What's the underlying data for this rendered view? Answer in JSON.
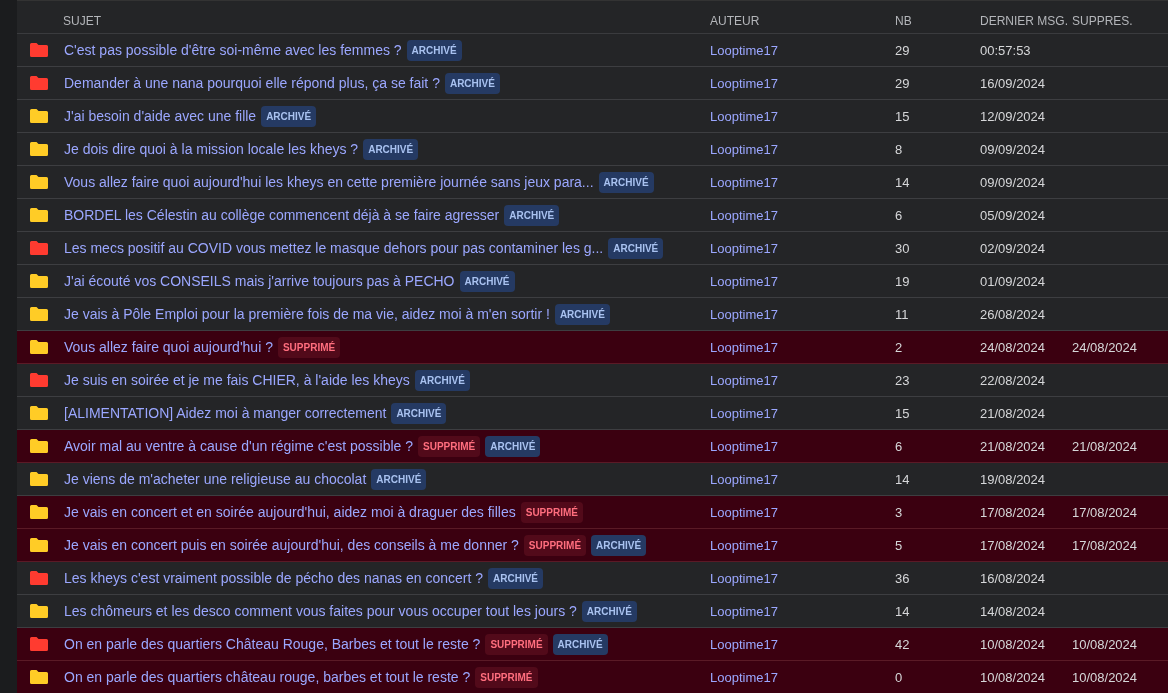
{
  "columns": [
    "SUJET",
    "AUTEUR",
    "NB",
    "DERNIER MSG.",
    "SUPPRES."
  ],
  "rows": [
    {
      "color": "#ff3b30",
      "deleted": false,
      "subject": "C'est pas possible d'être soi-même avec les femmes ?",
      "badges": [
        {
          "kind": "archived",
          "label": "ARCHIVÉ"
        }
      ],
      "author": "Looptime17",
      "count": "29",
      "last": "00:57:53"
    },
    {
      "color": "#ff3b30",
      "deleted": false,
      "subject": "Demander à une nana pourquoi elle répond plus, ça se fait ?",
      "badges": [
        {
          "kind": "archived",
          "label": "ARCHIVÉ"
        }
      ],
      "author": "Looptime17",
      "count": "29",
      "last": "16/09/2024"
    },
    {
      "color": "#ffcc26",
      "deleted": false,
      "subject": "J'ai besoin d'aide avec une fille",
      "badges": [
        {
          "kind": "archived",
          "label": "ARCHIVÉ"
        }
      ],
      "author": "Looptime17",
      "count": "15",
      "last": "12/09/2024"
    },
    {
      "color": "#ffcc26",
      "deleted": false,
      "subject": "Je dois dire quoi à la mission locale les kheys ?",
      "badges": [
        {
          "kind": "archived",
          "label": "ARCHIVÉ"
        }
      ],
      "author": "Looptime17",
      "count": "8",
      "last": "09/09/2024"
    },
    {
      "color": "#ffcc26",
      "deleted": false,
      "subject": "Vous allez faire quoi aujourd'hui les kheys en cette première journée sans jeux para...",
      "badges": [
        {
          "kind": "archived",
          "label": "ARCHIVÉ"
        }
      ],
      "author": "Looptime17",
      "count": "14",
      "last": "09/09/2024"
    },
    {
      "color": "#ffcc26",
      "deleted": false,
      "subject": "BORDEL les Célestin au collège commencent déjà à se faire agresser",
      "badges": [
        {
          "kind": "archived",
          "label": "ARCHIVÉ"
        }
      ],
      "author": "Looptime17",
      "count": "6",
      "last": "05/09/2024"
    },
    {
      "color": "#ff3b30",
      "deleted": false,
      "subject": "Les mecs positif au COVID vous mettez le masque dehors pour pas contaminer les g...",
      "badges": [
        {
          "kind": "archived",
          "label": "ARCHIVÉ"
        }
      ],
      "author": "Looptime17",
      "count": "30",
      "last": "02/09/2024"
    },
    {
      "color": "#ffcc26",
      "deleted": false,
      "subject": "J'ai écouté vos CONSEILS mais j'arrive toujours pas à PECHO",
      "badges": [
        {
          "kind": "archived",
          "label": "ARCHIVÉ"
        }
      ],
      "author": "Looptime17",
      "count": "19",
      "last": "01/09/2024"
    },
    {
      "color": "#ffcc26",
      "deleted": false,
      "subject": "Je vais à Pôle Emploi pour la première fois de ma vie, aidez moi à m'en sortir !",
      "badges": [
        {
          "kind": "archived",
          "label": "ARCHIVÉ"
        }
      ],
      "author": "Looptime17",
      "count": "11",
      "last": "26/08/2024"
    },
    {
      "color": "#ffcc26",
      "deleted": true,
      "subject": "Vous allez faire quoi aujourd'hui ?",
      "badges": [
        {
          "kind": "deleted",
          "label": "SUPPRIMÉ"
        }
      ],
      "author": "Looptime17",
      "count": "2",
      "last": "24/08/2024",
      "removed": "24/08/2024"
    },
    {
      "color": "#ff3b30",
      "deleted": false,
      "subject": "Je suis en soirée et je me fais CHIER, à l'aide les kheys",
      "badges": [
        {
          "kind": "archived",
          "label": "ARCHIVÉ"
        }
      ],
      "author": "Looptime17",
      "count": "23",
      "last": "22/08/2024"
    },
    {
      "color": "#ffcc26",
      "deleted": false,
      "subject": "[ALIMENTATION] Aidez moi à manger correctement",
      "badges": [
        {
          "kind": "archived",
          "label": "ARCHIVÉ"
        }
      ],
      "author": "Looptime17",
      "count": "15",
      "last": "21/08/2024"
    },
    {
      "color": "#ffcc26",
      "deleted": true,
      "subject": "Avoir mal au ventre à cause d'un régime c'est possible ?",
      "badges": [
        {
          "kind": "deleted",
          "label": "SUPPRIMÉ"
        },
        {
          "kind": "archived",
          "label": "ARCHIVÉ"
        }
      ],
      "author": "Looptime17",
      "count": "6",
      "last": "21/08/2024",
      "removed": "21/08/2024"
    },
    {
      "color": "#ffcc26",
      "deleted": false,
      "subject": "Je viens de m'acheter une religieuse au chocolat",
      "badges": [
        {
          "kind": "archived",
          "label": "ARCHIVÉ"
        }
      ],
      "author": "Looptime17",
      "count": "14",
      "last": "19/08/2024"
    },
    {
      "color": "#ffcc26",
      "deleted": true,
      "subject": "Je vais en concert et en soirée aujourd'hui, aidez moi à draguer des filles",
      "badges": [
        {
          "kind": "deleted",
          "label": "SUPPRIMÉ"
        }
      ],
      "author": "Looptime17",
      "count": "3",
      "last": "17/08/2024",
      "removed": "17/08/2024"
    },
    {
      "color": "#ffcc26",
      "deleted": true,
      "subject": "Je vais en concert puis en soirée aujourd'hui, des conseils à me donner ?",
      "badges": [
        {
          "kind": "deleted",
          "label": "SUPPRIMÉ"
        },
        {
          "kind": "archived",
          "label": "ARCHIVÉ"
        }
      ],
      "author": "Looptime17",
      "count": "5",
      "last": "17/08/2024",
      "removed": "17/08/2024"
    },
    {
      "color": "#ff3b30",
      "deleted": false,
      "subject": "Les kheys c'est vraiment possible de pécho des nanas en concert ?",
      "badges": [
        {
          "kind": "archived",
          "label": "ARCHIVÉ"
        }
      ],
      "author": "Looptime17",
      "count": "36",
      "last": "16/08/2024"
    },
    {
      "color": "#ffcc26",
      "deleted": false,
      "subject": "Les chômeurs et les desco comment vous faites pour vous occuper tout les jours ?",
      "badges": [
        {
          "kind": "archived",
          "label": "ARCHIVÉ"
        }
      ],
      "author": "Looptime17",
      "count": "14",
      "last": "14/08/2024"
    },
    {
      "color": "#ff3b30",
      "deleted": true,
      "subject": "On en parle des quartiers Château Rouge, Barbes et tout le reste ?",
      "badges": [
        {
          "kind": "deleted",
          "label": "SUPPRIMÉ"
        },
        {
          "kind": "archived",
          "label": "ARCHIVÉ"
        }
      ],
      "author": "Looptime17",
      "count": "42",
      "last": "10/08/2024",
      "removed": "10/08/2024"
    },
    {
      "color": "#ffcc26",
      "deleted": true,
      "subject": "On en parle des quartiers château rouge, barbes et tout le reste ?",
      "badges": [
        {
          "kind": "deleted",
          "label": "SUPPRIMÉ"
        }
      ],
      "author": "Looptime17",
      "count": "0",
      "last": "10/08/2024",
      "removed": "10/08/2024"
    }
  ]
}
